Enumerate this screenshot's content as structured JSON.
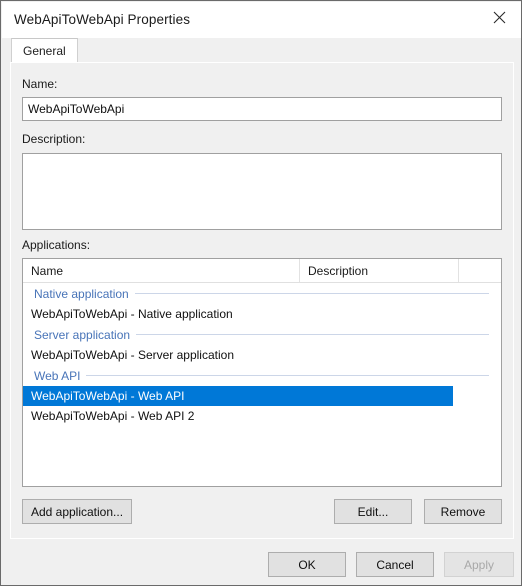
{
  "window": {
    "title": "WebApiToWebApi Properties",
    "close_icon": "close-icon"
  },
  "tabs": [
    {
      "label": "General",
      "selected": true
    }
  ],
  "form": {
    "name_label": "Name:",
    "name_value": "WebApiToWebApi",
    "name_placeholder": "",
    "description_label": "Description:",
    "description_value": "",
    "description_placeholder": "",
    "applications_label": "Applications:"
  },
  "applications_list": {
    "columns": [
      "Name",
      "Description"
    ],
    "groups": [
      {
        "header": "Native application",
        "rows": [
          {
            "name": "WebApiToWebApi - Native application",
            "description": "",
            "selected": false
          }
        ]
      },
      {
        "header": "Server application",
        "rows": [
          {
            "name": "WebApiToWebApi - Server application",
            "description": "",
            "selected": false
          }
        ]
      },
      {
        "header": "Web API",
        "rows": [
          {
            "name": "WebApiToWebApi - Web API",
            "description": "",
            "selected": true
          },
          {
            "name": "WebApiToWebApi - Web API 2",
            "description": "",
            "selected": false
          }
        ]
      }
    ]
  },
  "list_buttons": {
    "add": "Add application...",
    "edit": "Edit...",
    "remove": "Remove"
  },
  "dialog_buttons": {
    "ok": "OK",
    "cancel": "Cancel",
    "apply": "Apply",
    "apply_enabled": false
  },
  "colors": {
    "selection": "#0078d7",
    "group_header_text": "#4874b8",
    "group_header_rule": "#ccd6e8",
    "dialog_background": "#f0f0f0",
    "field_background": "#ffffff",
    "field_border": "#a0a0a0",
    "button_face": "#e1e1e1",
    "button_border": "#adadad",
    "disabled_text": "#a8a8a8"
  }
}
